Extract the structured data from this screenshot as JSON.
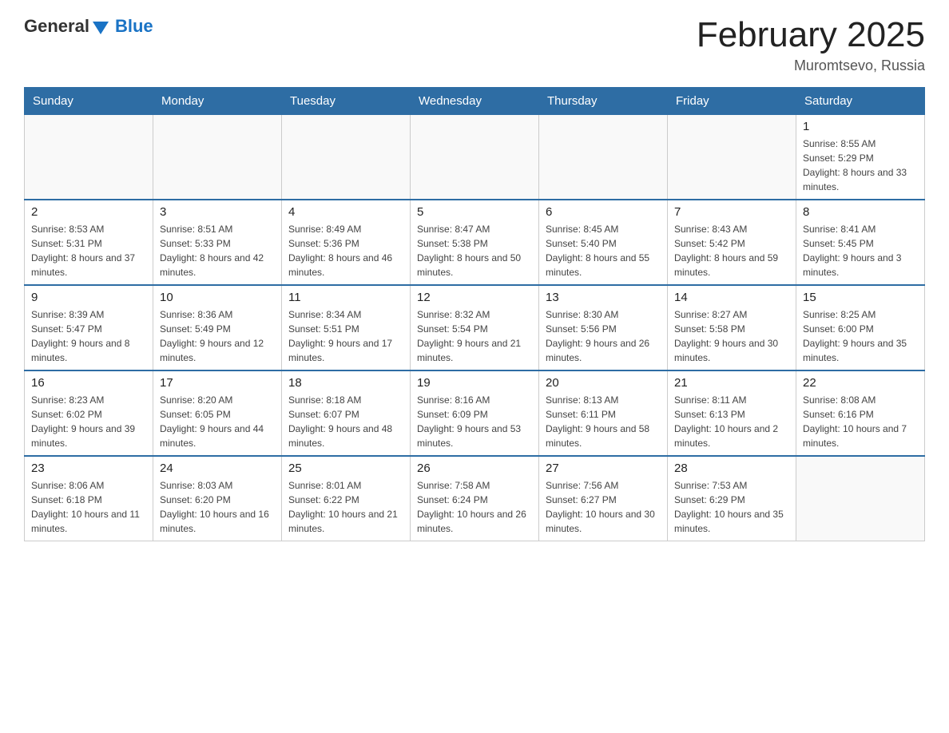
{
  "header": {
    "logo_general": "General",
    "logo_blue": "Blue",
    "title": "February 2025",
    "subtitle": "Muromtsevo, Russia"
  },
  "weekdays": [
    "Sunday",
    "Monday",
    "Tuesday",
    "Wednesday",
    "Thursday",
    "Friday",
    "Saturday"
  ],
  "weeks": [
    [
      {
        "day": "",
        "info": ""
      },
      {
        "day": "",
        "info": ""
      },
      {
        "day": "",
        "info": ""
      },
      {
        "day": "",
        "info": ""
      },
      {
        "day": "",
        "info": ""
      },
      {
        "day": "",
        "info": ""
      },
      {
        "day": "1",
        "info": "Sunrise: 8:55 AM\nSunset: 5:29 PM\nDaylight: 8 hours and 33 minutes."
      }
    ],
    [
      {
        "day": "2",
        "info": "Sunrise: 8:53 AM\nSunset: 5:31 PM\nDaylight: 8 hours and 37 minutes."
      },
      {
        "day": "3",
        "info": "Sunrise: 8:51 AM\nSunset: 5:33 PM\nDaylight: 8 hours and 42 minutes."
      },
      {
        "day": "4",
        "info": "Sunrise: 8:49 AM\nSunset: 5:36 PM\nDaylight: 8 hours and 46 minutes."
      },
      {
        "day": "5",
        "info": "Sunrise: 8:47 AM\nSunset: 5:38 PM\nDaylight: 8 hours and 50 minutes."
      },
      {
        "day": "6",
        "info": "Sunrise: 8:45 AM\nSunset: 5:40 PM\nDaylight: 8 hours and 55 minutes."
      },
      {
        "day": "7",
        "info": "Sunrise: 8:43 AM\nSunset: 5:42 PM\nDaylight: 8 hours and 59 minutes."
      },
      {
        "day": "8",
        "info": "Sunrise: 8:41 AM\nSunset: 5:45 PM\nDaylight: 9 hours and 3 minutes."
      }
    ],
    [
      {
        "day": "9",
        "info": "Sunrise: 8:39 AM\nSunset: 5:47 PM\nDaylight: 9 hours and 8 minutes."
      },
      {
        "day": "10",
        "info": "Sunrise: 8:36 AM\nSunset: 5:49 PM\nDaylight: 9 hours and 12 minutes."
      },
      {
        "day": "11",
        "info": "Sunrise: 8:34 AM\nSunset: 5:51 PM\nDaylight: 9 hours and 17 minutes."
      },
      {
        "day": "12",
        "info": "Sunrise: 8:32 AM\nSunset: 5:54 PM\nDaylight: 9 hours and 21 minutes."
      },
      {
        "day": "13",
        "info": "Sunrise: 8:30 AM\nSunset: 5:56 PM\nDaylight: 9 hours and 26 minutes."
      },
      {
        "day": "14",
        "info": "Sunrise: 8:27 AM\nSunset: 5:58 PM\nDaylight: 9 hours and 30 minutes."
      },
      {
        "day": "15",
        "info": "Sunrise: 8:25 AM\nSunset: 6:00 PM\nDaylight: 9 hours and 35 minutes."
      }
    ],
    [
      {
        "day": "16",
        "info": "Sunrise: 8:23 AM\nSunset: 6:02 PM\nDaylight: 9 hours and 39 minutes."
      },
      {
        "day": "17",
        "info": "Sunrise: 8:20 AM\nSunset: 6:05 PM\nDaylight: 9 hours and 44 minutes."
      },
      {
        "day": "18",
        "info": "Sunrise: 8:18 AM\nSunset: 6:07 PM\nDaylight: 9 hours and 48 minutes."
      },
      {
        "day": "19",
        "info": "Sunrise: 8:16 AM\nSunset: 6:09 PM\nDaylight: 9 hours and 53 minutes."
      },
      {
        "day": "20",
        "info": "Sunrise: 8:13 AM\nSunset: 6:11 PM\nDaylight: 9 hours and 58 minutes."
      },
      {
        "day": "21",
        "info": "Sunrise: 8:11 AM\nSunset: 6:13 PM\nDaylight: 10 hours and 2 minutes."
      },
      {
        "day": "22",
        "info": "Sunrise: 8:08 AM\nSunset: 6:16 PM\nDaylight: 10 hours and 7 minutes."
      }
    ],
    [
      {
        "day": "23",
        "info": "Sunrise: 8:06 AM\nSunset: 6:18 PM\nDaylight: 10 hours and 11 minutes."
      },
      {
        "day": "24",
        "info": "Sunrise: 8:03 AM\nSunset: 6:20 PM\nDaylight: 10 hours and 16 minutes."
      },
      {
        "day": "25",
        "info": "Sunrise: 8:01 AM\nSunset: 6:22 PM\nDaylight: 10 hours and 21 minutes."
      },
      {
        "day": "26",
        "info": "Sunrise: 7:58 AM\nSunset: 6:24 PM\nDaylight: 10 hours and 26 minutes."
      },
      {
        "day": "27",
        "info": "Sunrise: 7:56 AM\nSunset: 6:27 PM\nDaylight: 10 hours and 30 minutes."
      },
      {
        "day": "28",
        "info": "Sunrise: 7:53 AM\nSunset: 6:29 PM\nDaylight: 10 hours and 35 minutes."
      },
      {
        "day": "",
        "info": ""
      }
    ]
  ]
}
